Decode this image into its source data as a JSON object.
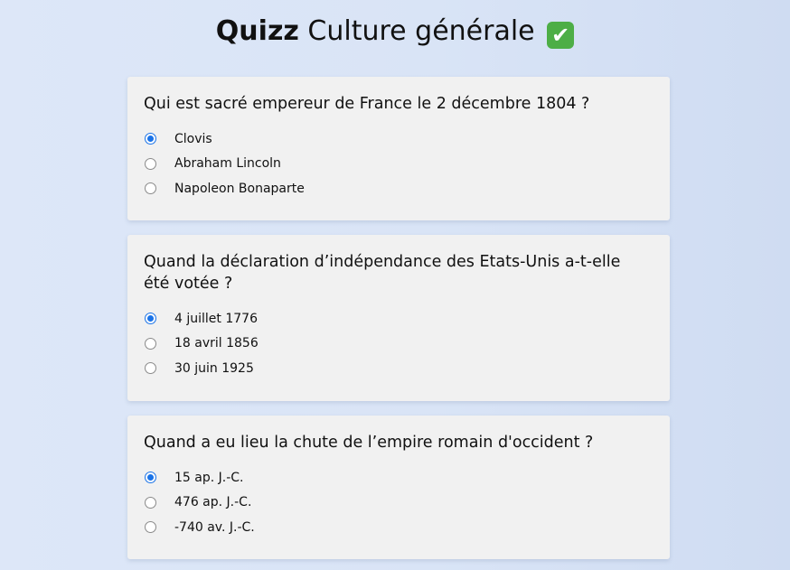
{
  "title": {
    "bold": "Quizz",
    "rest": "Culture générale",
    "emoji": "✔"
  },
  "questions": [
    {
      "text": "Qui est sacré empereur de France le 2 décembre 1804 ?",
      "options": [
        "Clovis",
        "Abraham Lincoln",
        "Napoleon Bonaparte"
      ],
      "selected_index": 0
    },
    {
      "text": "Quand la déclaration d’indépendance des Etats-Unis a-t-elle été votée ?",
      "options": [
        "4 juillet 1776",
        "18 avril 1856",
        "30 juin 1925"
      ],
      "selected_index": 0
    },
    {
      "text": "Quand a eu lieu la chute de l’empire romain d'occident ?",
      "options": [
        "15 ap. J.-C.",
        "476 ap. J.-C.",
        "-740 av. J.-C."
      ],
      "selected_index": 0
    }
  ],
  "colors": {
    "accent": "#1a73e8",
    "card_background": "#f1f1f1",
    "check_emoji": "#4dae46"
  }
}
